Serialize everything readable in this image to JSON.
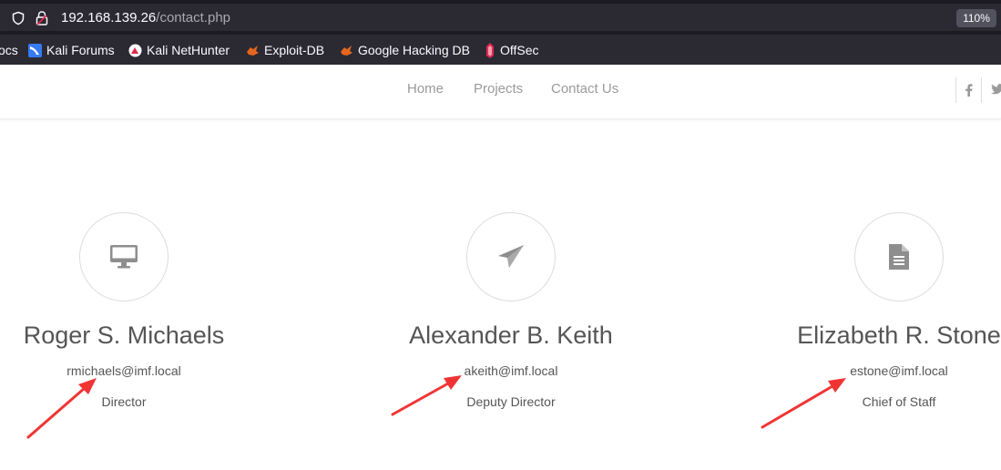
{
  "browser": {
    "url_host": "192.168.139.26",
    "url_path": "/contact.php",
    "zoom": "110%",
    "bookmarks": [
      {
        "label": "ocs",
        "icon": "docs-icon"
      },
      {
        "label": "Kali Forums",
        "icon": "kali-forums-icon"
      },
      {
        "label": "Kali NetHunter",
        "icon": "kali-nethunter-icon"
      },
      {
        "label": "Exploit-DB",
        "icon": "exploit-db-icon"
      },
      {
        "label": "Google Hacking DB",
        "icon": "google-hacking-db-icon"
      },
      {
        "label": "OffSec",
        "icon": "offsec-icon"
      }
    ]
  },
  "nav": {
    "items": [
      "Home",
      "Projects",
      "Contact Us"
    ],
    "social": [
      "facebook-icon",
      "twitter-icon"
    ]
  },
  "contacts": [
    {
      "icon": "monitor-icon",
      "name": "Roger S. Michaels",
      "email": "rmichaels@imf.local",
      "role": "Director"
    },
    {
      "icon": "paper-plane-icon",
      "name": "Alexander B. Keith",
      "email": "akeith@imf.local",
      "role": "Deputy Director"
    },
    {
      "icon": "document-icon",
      "name": "Elizabeth R. Stone",
      "email": "estone@imf.local",
      "role": "Chief of Staff"
    }
  ],
  "annotations": {
    "arrow_color": "#f03434"
  }
}
